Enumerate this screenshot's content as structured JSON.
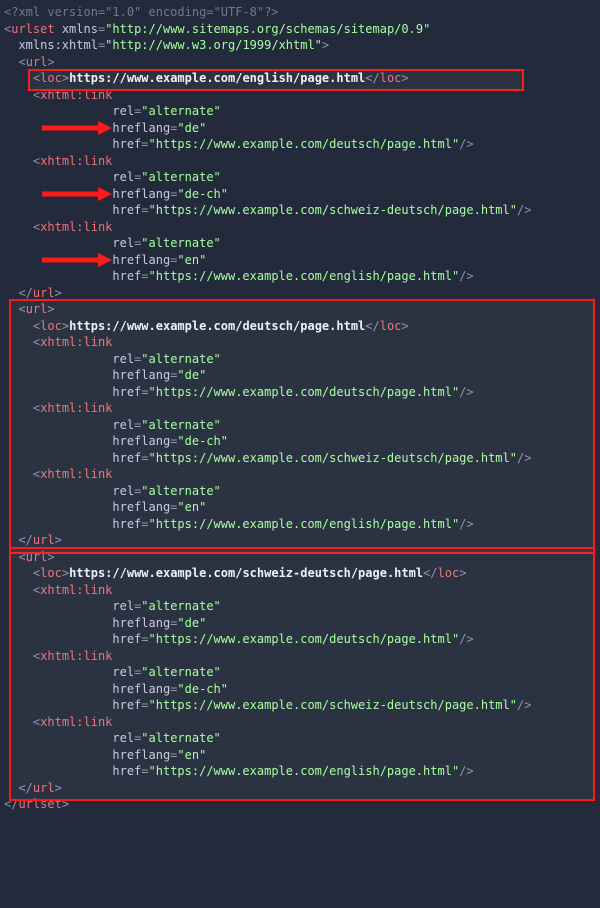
{
  "xml_decl": {
    "raw_open": "<?",
    "name": "xml",
    "attrs": " version=\"1.0\" encoding=\"UTF-8\"",
    "raw_close": "?>"
  },
  "urlset_open": {
    "attr1_name": "xmlns",
    "attr1_val": "http://www.sitemaps.org/schemas/sitemap/0.9",
    "attr2_name": "xmlns:xhtml",
    "attr2_val": "http://www.w3.org/1999/xhtml"
  },
  "blocks": [
    {
      "loc": "https://www.example.com/english/page.html",
      "links": [
        {
          "rel": "alternate",
          "hreflang": "de",
          "href": "https://www.example.com/deutsch/page.html"
        },
        {
          "rel": "alternate",
          "hreflang": "de-ch",
          "href": "https://www.example.com/schweiz-deutsch/page.html"
        },
        {
          "rel": "alternate",
          "hreflang": "en",
          "href": "https://www.example.com/english/page.html"
        }
      ]
    },
    {
      "loc": "https://www.example.com/deutsch/page.html",
      "links": [
        {
          "rel": "alternate",
          "hreflang": "de",
          "href": "https://www.example.com/deutsch/page.html"
        },
        {
          "rel": "alternate",
          "hreflang": "de-ch",
          "href": "https://www.example.com/schweiz-deutsch/page.html"
        },
        {
          "rel": "alternate",
          "hreflang": "en",
          "href": "https://www.example.com/english/page.html"
        }
      ]
    },
    {
      "loc": "https://www.example.com/schweiz-deutsch/page.html",
      "links": [
        {
          "rel": "alternate",
          "hreflang": "de",
          "href": "https://www.example.com/deutsch/page.html"
        },
        {
          "rel": "alternate",
          "hreflang": "de-ch",
          "href": "https://www.example.com/schweiz-deutsch/page.html"
        },
        {
          "rel": "alternate",
          "hreflang": "en",
          "href": "https://www.example.com/english/page.html"
        }
      ]
    }
  ],
  "annotations": {
    "loc_highlight_block": 0,
    "large_highlight_blocks": [
      1,
      2
    ],
    "arrow_targets": [
      {
        "block": 0,
        "link": 0
      },
      {
        "block": 0,
        "link": 1
      },
      {
        "block": 0,
        "link": 2
      }
    ]
  }
}
